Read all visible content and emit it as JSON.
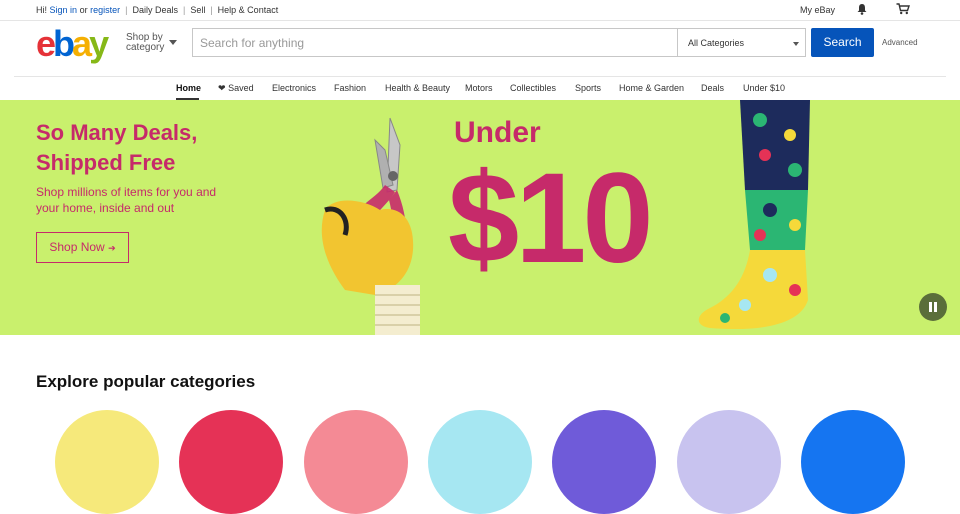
{
  "topbar": {
    "greeting": "Hi!",
    "sign_in": "Sign in",
    "or": "or",
    "register": "register",
    "links": [
      "Daily Deals",
      "Sell",
      "Help & Contact"
    ],
    "my_ebay": "My eBay"
  },
  "header": {
    "logo": {
      "e": "e",
      "b": "b",
      "a": "a",
      "y": "y"
    },
    "shop_by": "Shop by",
    "category": "category",
    "search_placeholder": "Search for anything",
    "category_select": "All Categories",
    "search_button": "Search",
    "advanced": "Advanced"
  },
  "nav": {
    "items": [
      "Home",
      "Saved",
      "Electronics",
      "Fashion",
      "Health & Beauty",
      "Motors",
      "Collectibles",
      "Sports",
      "Home & Garden",
      "Deals",
      "Under $10"
    ]
  },
  "hero": {
    "title_line1": "So Many Deals,",
    "title_line2": "Shipped Free",
    "subtitle": "Shop millions of items for you and your home, inside and out",
    "cta": "Shop Now",
    "cta_arrow": "➔",
    "under": "Under",
    "price": "$10"
  },
  "categories": {
    "title": "Explore popular categories",
    "circle_colors": [
      "#f6e97b",
      "#e53256",
      "#f48a95",
      "#a6e7f2",
      "#6f5bd9",
      "#c8c3ef",
      "#1575f1"
    ]
  },
  "colors": {
    "brand_blue": "#0654ba",
    "hero_bg": "#c9f06d",
    "hero_accent": "#c62a6a"
  }
}
